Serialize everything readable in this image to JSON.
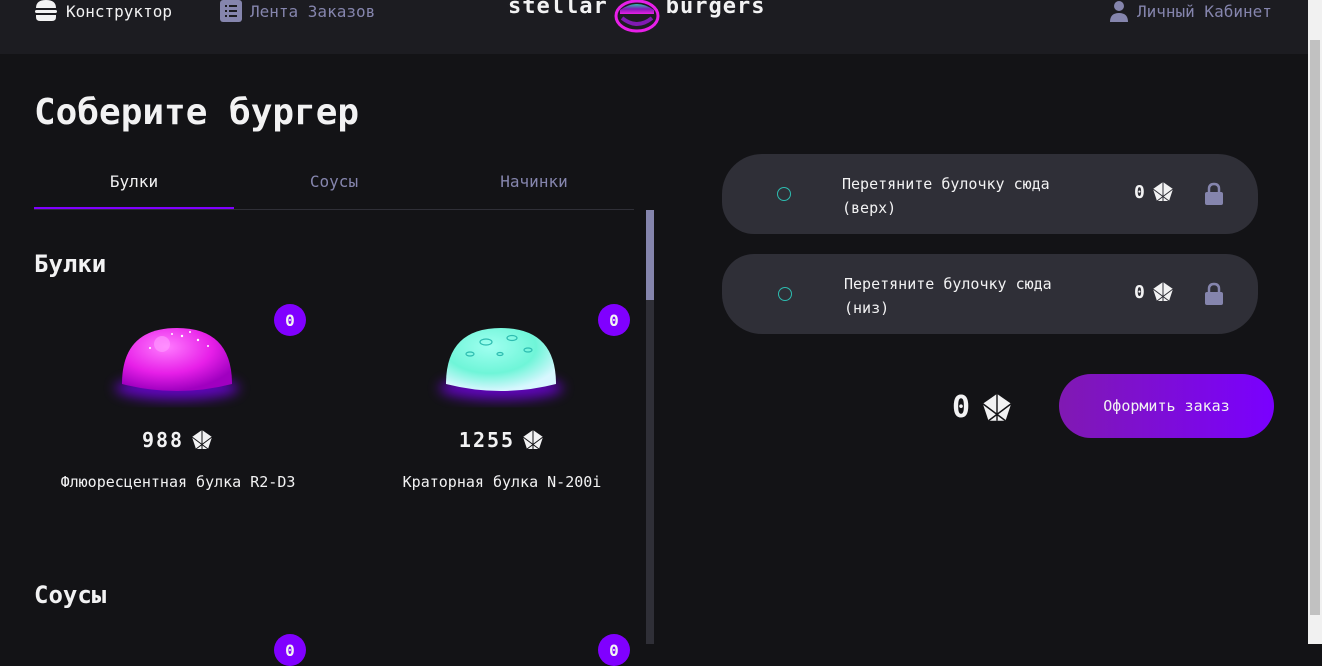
{
  "header": {
    "nav": {
      "constructor": "Конструктор",
      "feed": "Лента Заказов",
      "profile": "Личный Кабинет"
    },
    "logo": {
      "left": "stellar",
      "right": "burgers"
    }
  },
  "main": {
    "title": "Соберите бургер",
    "tabs": [
      {
        "label": "Булки",
        "active": true
      },
      {
        "label": "Соусы",
        "active": false
      },
      {
        "label": "Начинки",
        "active": false
      }
    ],
    "sections": {
      "buns_title": "Булки",
      "sauces_title": "Соусы"
    },
    "buns": [
      {
        "name": "Флюоресцентная булка R2-D3",
        "price": "988",
        "count": "0",
        "color": "#E71FE8"
      },
      {
        "name": "Краторная булка N-200i",
        "price": "1255",
        "count": "0",
        "color": "#6FF5D8"
      }
    ],
    "sauce_counters": [
      "0",
      "0"
    ]
  },
  "constructor": {
    "top": {
      "text": "Перетяните булочку сюда (верх)",
      "price": "0"
    },
    "bottom": {
      "text": "Перетяните булочку сюда (низ)",
      "price": "0"
    },
    "total": "0",
    "order_button": "Оформить заказ"
  },
  "colors": {
    "background": "#131316",
    "header": "#1C1C21",
    "accent": "#8000FF",
    "slot": "#2F2F37",
    "inactive": "#8585AD"
  }
}
